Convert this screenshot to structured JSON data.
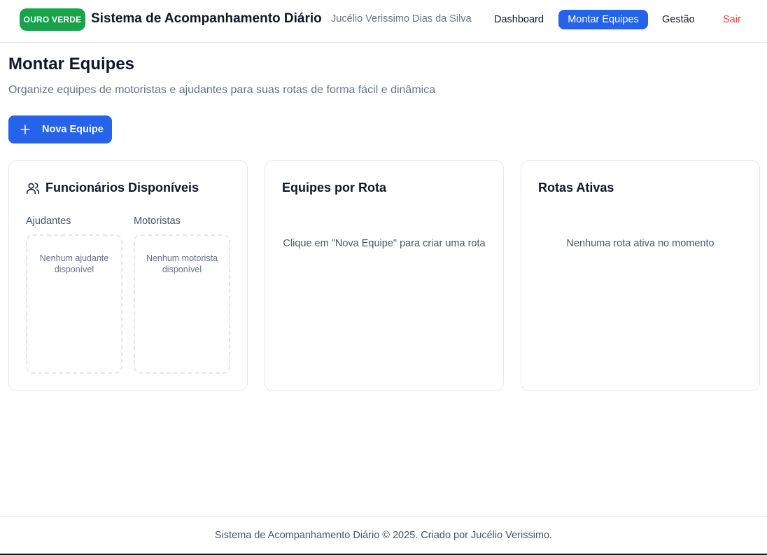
{
  "header": {
    "brand": "OURO VERDE",
    "app_title": "Sistema de Acompanhamento Diário",
    "user_name": "Jucélio Verissimo Dias da Silva",
    "nav": {
      "dashboard": "Dashboard",
      "montar_equipes": "Montar Equipes",
      "gestao": "Gestão",
      "sair": "Sair"
    }
  },
  "page": {
    "title": "Montar Equipes",
    "subtitle": "Organize equipes de motoristas e ajudantes para suas rotas de forma fácil e dinâmica",
    "new_team_button": "Nova Equipe",
    "new_team_icon": "plus-icon"
  },
  "cards": {
    "funcionarios": {
      "title": "Funcionários Disponíveis",
      "icon": "users-icon",
      "ajudantes_label": "Ajudantes",
      "ajudantes_empty": "Nenhum ajudante disponível",
      "motoristas_label": "Motoristas",
      "motoristas_empty": "Nenhum motorista disponível"
    },
    "equipes": {
      "title": "Equipes por Rota",
      "empty": "Clique em \"Nova Equipe\" para criar uma rota"
    },
    "rotas": {
      "title": "Rotas Ativas",
      "empty": "Nenhuma rota ativa no momento"
    }
  },
  "footer": {
    "text": "Sistema de Acompanhamento Diário © 2025. Criado por Jucélio Verissimo."
  },
  "colors": {
    "brand_green": "#16a34a",
    "primary_blue": "#2563eb",
    "danger_red": "#ef4444",
    "muted_text": "#64748b"
  }
}
